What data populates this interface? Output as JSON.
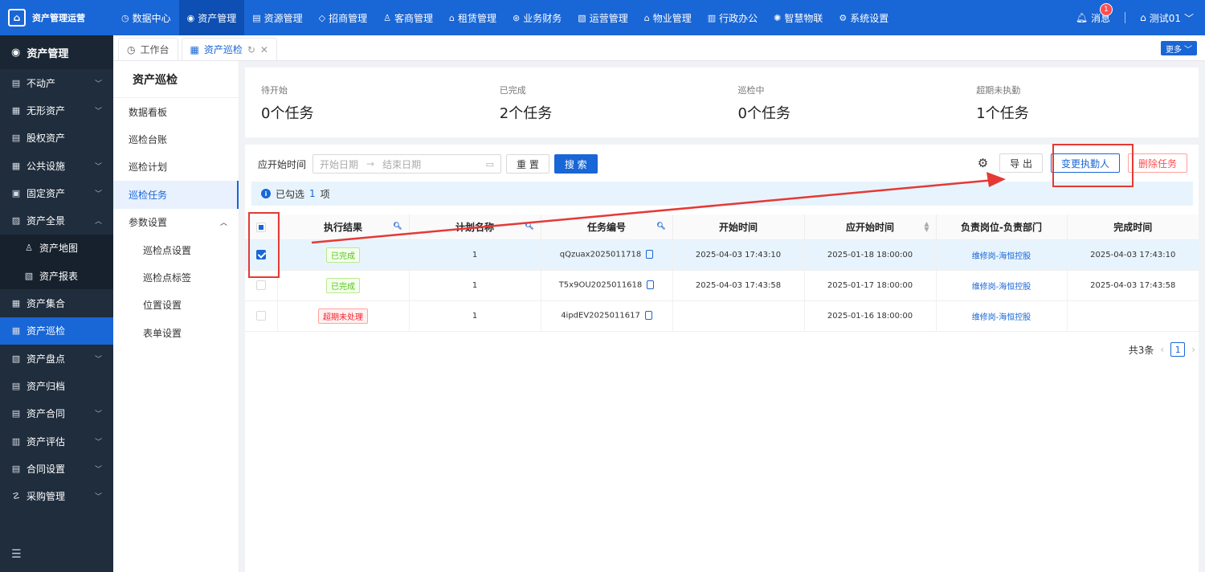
{
  "topbar": {
    "brand": "资产管理运营",
    "nav": [
      {
        "label": "数据中心",
        "icon": "◷"
      },
      {
        "label": "资产管理",
        "icon": "◉"
      },
      {
        "label": "资源管理",
        "icon": "▤"
      },
      {
        "label": "招商管理",
        "icon": "◇"
      },
      {
        "label": "客商管理",
        "icon": "♙"
      },
      {
        "label": "租赁管理",
        "icon": "⌂"
      },
      {
        "label": "业务财务",
        "icon": "⊛"
      },
      {
        "label": "运营管理",
        "icon": "▧"
      },
      {
        "label": "物业管理",
        "icon": "⌂"
      },
      {
        "label": "行政办公",
        "icon": "▥"
      },
      {
        "label": "智慧物联",
        "icon": "✺"
      },
      {
        "label": "系统设置",
        "icon": "⚙"
      }
    ],
    "messages_label": "消息",
    "message_count": "1",
    "user_label": "测试01"
  },
  "sidebar": {
    "header": "资产管理",
    "items": [
      {
        "label": "不动产",
        "icon": "▤",
        "chev": "﹀"
      },
      {
        "label": "无形资产",
        "icon": "▦",
        "chev": "﹀"
      },
      {
        "label": "股权资产",
        "icon": "▤",
        "chev": ""
      },
      {
        "label": "公共设施",
        "icon": "▦",
        "chev": "﹀"
      },
      {
        "label": "固定资产",
        "icon": "▣",
        "chev": "﹀"
      },
      {
        "label": "资产全景",
        "icon": "▨",
        "chev": "︿"
      },
      {
        "label": "资产地图",
        "icon": "♙",
        "chev": "",
        "sub": true
      },
      {
        "label": "资产报表",
        "icon": "▧",
        "chev": "",
        "sub": true
      },
      {
        "label": "资产集合",
        "icon": "▦",
        "chev": ""
      },
      {
        "label": "资产巡检",
        "icon": "▦",
        "chev": "",
        "active": true
      },
      {
        "label": "资产盘点",
        "icon": "▧",
        "chev": "﹀"
      },
      {
        "label": "资产归档",
        "icon": "▤",
        "chev": ""
      },
      {
        "label": "资产合同",
        "icon": "▤",
        "chev": "﹀"
      },
      {
        "label": "资产评估",
        "icon": "▥",
        "chev": "﹀"
      },
      {
        "label": "合同设置",
        "icon": "▤",
        "chev": "﹀"
      },
      {
        "label": "采购管理",
        "icon": "☡",
        "chev": "﹀"
      }
    ]
  },
  "tabs": [
    {
      "label": "工作台",
      "icon": "◷"
    },
    {
      "label": "资产巡检",
      "icon": "▦",
      "active": true
    }
  ],
  "more_label": "更多",
  "subpanel": {
    "title": "资产巡检",
    "items": [
      {
        "label": "数据看板"
      },
      {
        "label": "巡检台账"
      },
      {
        "label": "巡检计划"
      },
      {
        "label": "巡检任务",
        "active": true
      },
      {
        "label": "参数设置",
        "chev": "︿"
      },
      {
        "label": "巡检点设置",
        "indent": true
      },
      {
        "label": "巡检点标签",
        "indent": true
      },
      {
        "label": "位置设置",
        "indent": true
      },
      {
        "label": "表单设置",
        "indent": true
      }
    ]
  },
  "stats": [
    {
      "label": "待开始",
      "value": "0个任务"
    },
    {
      "label": "已完成",
      "value": "2个任务"
    },
    {
      "label": "巡检中",
      "value": "0个任务"
    },
    {
      "label": "超期未执勤",
      "value": "1个任务"
    }
  ],
  "filter": {
    "label": "应开始时间",
    "start_placeholder": "开始日期",
    "end_placeholder": "结束日期",
    "reset": "重 置",
    "search": "搜 索"
  },
  "actions": {
    "export": "导 出",
    "change_executor": "变更执勤人",
    "delete_task": "删除任务"
  },
  "selection": {
    "prefix": "已勾选",
    "count": "1",
    "suffix": "项"
  },
  "table": {
    "headers": [
      "执行结果",
      "计划名称",
      "任务编号",
      "开始时间",
      "应开始时间",
      "负责岗位-负责部门",
      "完成时间"
    ],
    "rows": [
      {
        "checked": true,
        "result": "已完成",
        "result_type": "done",
        "plan": "1",
        "code": "qQzuax2025011718",
        "start": "2025-04-03 17:43:10",
        "due": "2025-01-18 18:00:00",
        "owner": "维修岗-海恒控股",
        "finish": "2025-04-03 17:43:10"
      },
      {
        "checked": false,
        "result": "已完成",
        "result_type": "done",
        "plan": "1",
        "code": "T5x9OU2025011618",
        "start": "2025-04-03 17:43:58",
        "due": "2025-01-17 18:00:00",
        "owner": "维修岗-海恒控股",
        "finish": "2025-04-03 17:43:58"
      },
      {
        "checked": false,
        "result": "超期未处理",
        "result_type": "overdue",
        "plan": "1",
        "code": "4ipdEV2025011617",
        "start": "",
        "due": "2025-01-16 18:00:00",
        "owner": "维修岗-海恒控股",
        "finish": ""
      }
    ]
  },
  "pagination": {
    "total_label": "共3条",
    "current_page": "1"
  },
  "colors": {
    "primary": "#1966d6",
    "sidebar": "#1f2d3d",
    "annotation": "#e53935"
  }
}
